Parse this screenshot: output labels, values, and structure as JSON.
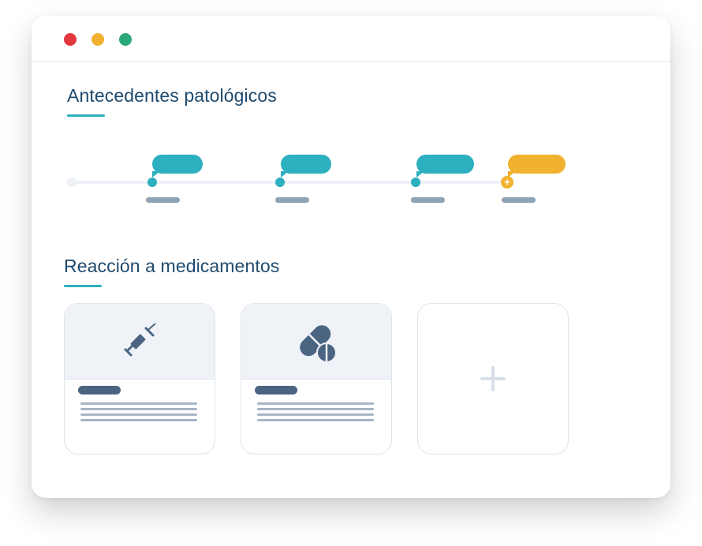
{
  "window": {
    "controls": [
      {
        "name": "close",
        "color": "#e2373d"
      },
      {
        "name": "minimize",
        "color": "#efb12e"
      },
      {
        "name": "maximize",
        "color": "#2aa87a"
      }
    ]
  },
  "colors": {
    "title": "#1e4a6e",
    "accent_teal": "#2db0bf",
    "accent_yellow": "#f0b22f",
    "card_icon": "#4a6482"
  },
  "pathological_history": {
    "title": "Antecedentes patológicos",
    "timeline": [
      {
        "type": "event",
        "icon": "dot-node",
        "bubble_color": "#2db0bf"
      },
      {
        "type": "event",
        "icon": "dot-node",
        "bubble_color": "#2db0bf"
      },
      {
        "type": "event",
        "icon": "dot-node",
        "bubble_color": "#2db0bf"
      },
      {
        "type": "add",
        "icon": "plus-node",
        "add_symbol": "+",
        "bubble_color": "#f0b22f"
      }
    ]
  },
  "drug_reactions": {
    "title": "Reacción a medicamentos",
    "cards": [
      {
        "icon": "syringe-icon"
      },
      {
        "icon": "pills-icon"
      }
    ],
    "add_card": {
      "icon": "plus-icon"
    }
  }
}
